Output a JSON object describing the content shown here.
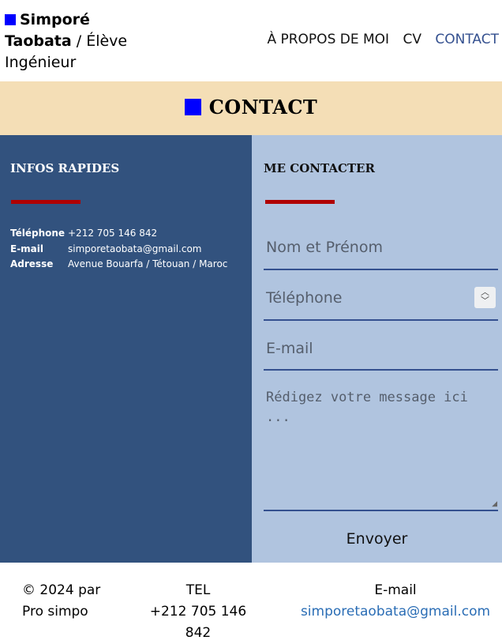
{
  "header": {
    "brand_name_first": "Simporé",
    "brand_name_last": "Taobata",
    "brand_role": " / Élève Ingénieur",
    "nav": [
      {
        "label": "À PROPOS DE MOI"
      },
      {
        "label": "CV"
      },
      {
        "label": "CONTACT",
        "active": true
      }
    ]
  },
  "banner": {
    "title": "CONTACT"
  },
  "infos": {
    "title": "INFOS RAPIDES",
    "rows": [
      {
        "key": "Téléphone",
        "value": "+212 705 146 842"
      },
      {
        "key": "E-mail",
        "value": "simporetaobata@gmail.com"
      },
      {
        "key": "Adresse",
        "value": "Avenue Bouarfa / Tétouan / Maroc"
      }
    ]
  },
  "form": {
    "title": "ME CONTACTER",
    "name_placeholder": "Nom et Prénom",
    "phone_placeholder": "Téléphone",
    "email_placeholder": "E-mail",
    "message_placeholder": "Rédigez votre message ici ...",
    "submit_label": "Envoyer"
  },
  "footer": {
    "copyright_line1": "© 2024 par",
    "copyright_line2": "Pro simpo",
    "tel_label": "TEL",
    "tel_value": "+212 705 146 842",
    "email_label": "E-mail",
    "email_value": "simporetaobata@gmail.com"
  },
  "colors": {
    "accent_blue": "#0000ff",
    "left_panel": "#32527e",
    "right_panel": "#b0c4df",
    "banner": "#f4deb6",
    "underline_red": "#b00000"
  }
}
